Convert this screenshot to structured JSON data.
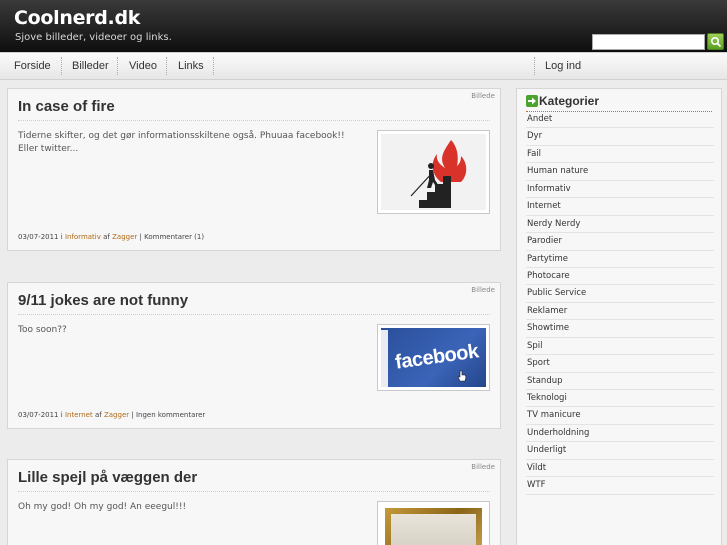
{
  "header": {
    "site_title": "Coolnerd.dk",
    "tagline": "Sjove billeder, videoer og links.",
    "search_value": "",
    "search_button_icon": "search-icon"
  },
  "nav": {
    "items": [
      "Forside",
      "Billeder",
      "Video",
      "Links"
    ],
    "login": "Log ind"
  },
  "posts": [
    {
      "title": "In case of fire",
      "type": "Billede",
      "excerpt": "Tiderne skifter, og det gør informationsskiltene også. Phuuaa facebook!! Eller twitter...",
      "meta": {
        "date": "03/07-2011",
        "in": "i",
        "category": "Informativ",
        "by": "af",
        "author": "Zagger",
        "comments": "| Kommentarer (1)"
      },
      "thumb": "fire-exit-sign"
    },
    {
      "title": "9/11 jokes are not funny",
      "type": "Billede",
      "excerpt": "Too soon??",
      "meta": {
        "date": "03/07-2011",
        "in": "i",
        "category": "Internet",
        "by": "af",
        "author": "Zagger",
        "comments": "| Ingen kommentarer"
      },
      "thumb": "facebook-logo",
      "thumb_text": "facebook"
    },
    {
      "title": "Lille spejl på væggen der",
      "type": "Billede",
      "excerpt": "Oh my god! Oh my god! An eeegul!!!",
      "thumb": "golden-mirror"
    }
  ],
  "sidebar": {
    "title": "Kategorier",
    "categories": [
      "Andet",
      "Dyr",
      "Fail",
      "Human nature",
      "Informativ",
      "Internet",
      "Nerdy Nerdy",
      "Parodier",
      "Partytime",
      "Photocare",
      "Public Service",
      "Reklamer",
      "Showtime",
      "Spil",
      "Sport",
      "Standup",
      "Teknologi",
      "TV manicure",
      "Underholdning",
      "Underligt",
      "Vildt",
      "WTF"
    ]
  },
  "colors": {
    "header_bg": "#1a1a1a",
    "link": "#b06a19",
    "accent_green": "#5a9e1e"
  }
}
